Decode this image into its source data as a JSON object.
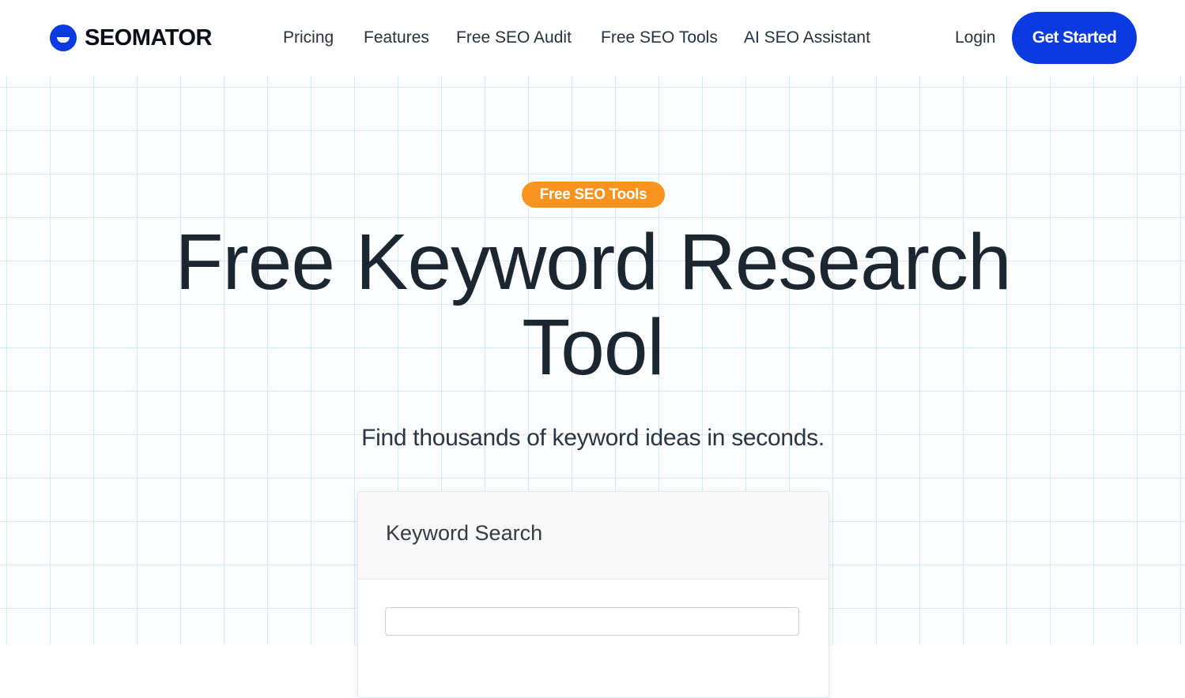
{
  "header": {
    "brand": "SEOMATOR",
    "nav": [
      {
        "label": "Pricing"
      },
      {
        "label": "Features"
      },
      {
        "label": "Free SEO Audit"
      },
      {
        "label": "Free SEO Tools"
      },
      {
        "label": "AI SEO Assistant"
      }
    ],
    "login_label": "Login",
    "cta_label": "Get Started"
  },
  "hero": {
    "badge": "Free SEO Tools",
    "title_line1": "Free Keyword Research",
    "title_line2": "Tool",
    "subtitle": "Find thousands of keyword ideas in seconds."
  },
  "search_card": {
    "title": "Keyword Search",
    "input_value": "",
    "input_placeholder": ""
  },
  "colors": {
    "accent": "#0a3be0",
    "badge": "#f7931e",
    "heading": "#1b2631"
  }
}
